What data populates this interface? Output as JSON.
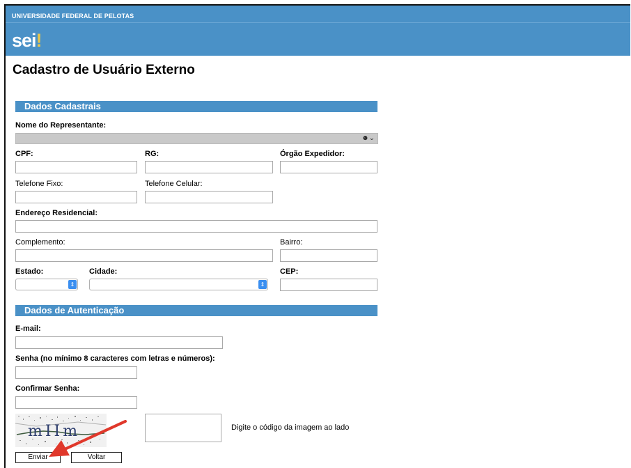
{
  "header": {
    "institution": "UNIVERSIDADE FEDERAL DE PELOTAS",
    "logo_main": "sei",
    "logo_mark": "!"
  },
  "page_title": "Cadastro de Usuário Externo",
  "sections": {
    "dados_cadastrais": "Dados Cadastrais",
    "dados_autenticacao": "Dados de Autenticação"
  },
  "form": {
    "nome_representante_label": "Nome do Representante:",
    "nome_representante_icon": "person-chevron-icon",
    "cpf_label": "CPF:",
    "rg_label": "RG:",
    "orgao_label": "Órgão Expedidor:",
    "telefone_fixo_label": "Telefone Fixo:",
    "telefone_celular_label": "Telefone Celular:",
    "endereco_label": "Endereço Residencial:",
    "complemento_label": "Complemento:",
    "bairro_label": "Bairro:",
    "estado_label": "Estado:",
    "cidade_label": "Cidade:",
    "cep_label": "CEP:",
    "email_label": "E-mail:",
    "senha_label": "Senha (no mínimo 8 caracteres com letras e números):",
    "confirmar_senha_label": "Confirmar Senha:",
    "captcha_hint": "Digite o código da imagem ao lado",
    "captcha_code": "mIIm"
  },
  "buttons": {
    "enviar": "Enviar",
    "voltar": "Voltar"
  },
  "colors": {
    "header_blue": "#4a91c7",
    "annotation_arrow": "#e0382b"
  }
}
